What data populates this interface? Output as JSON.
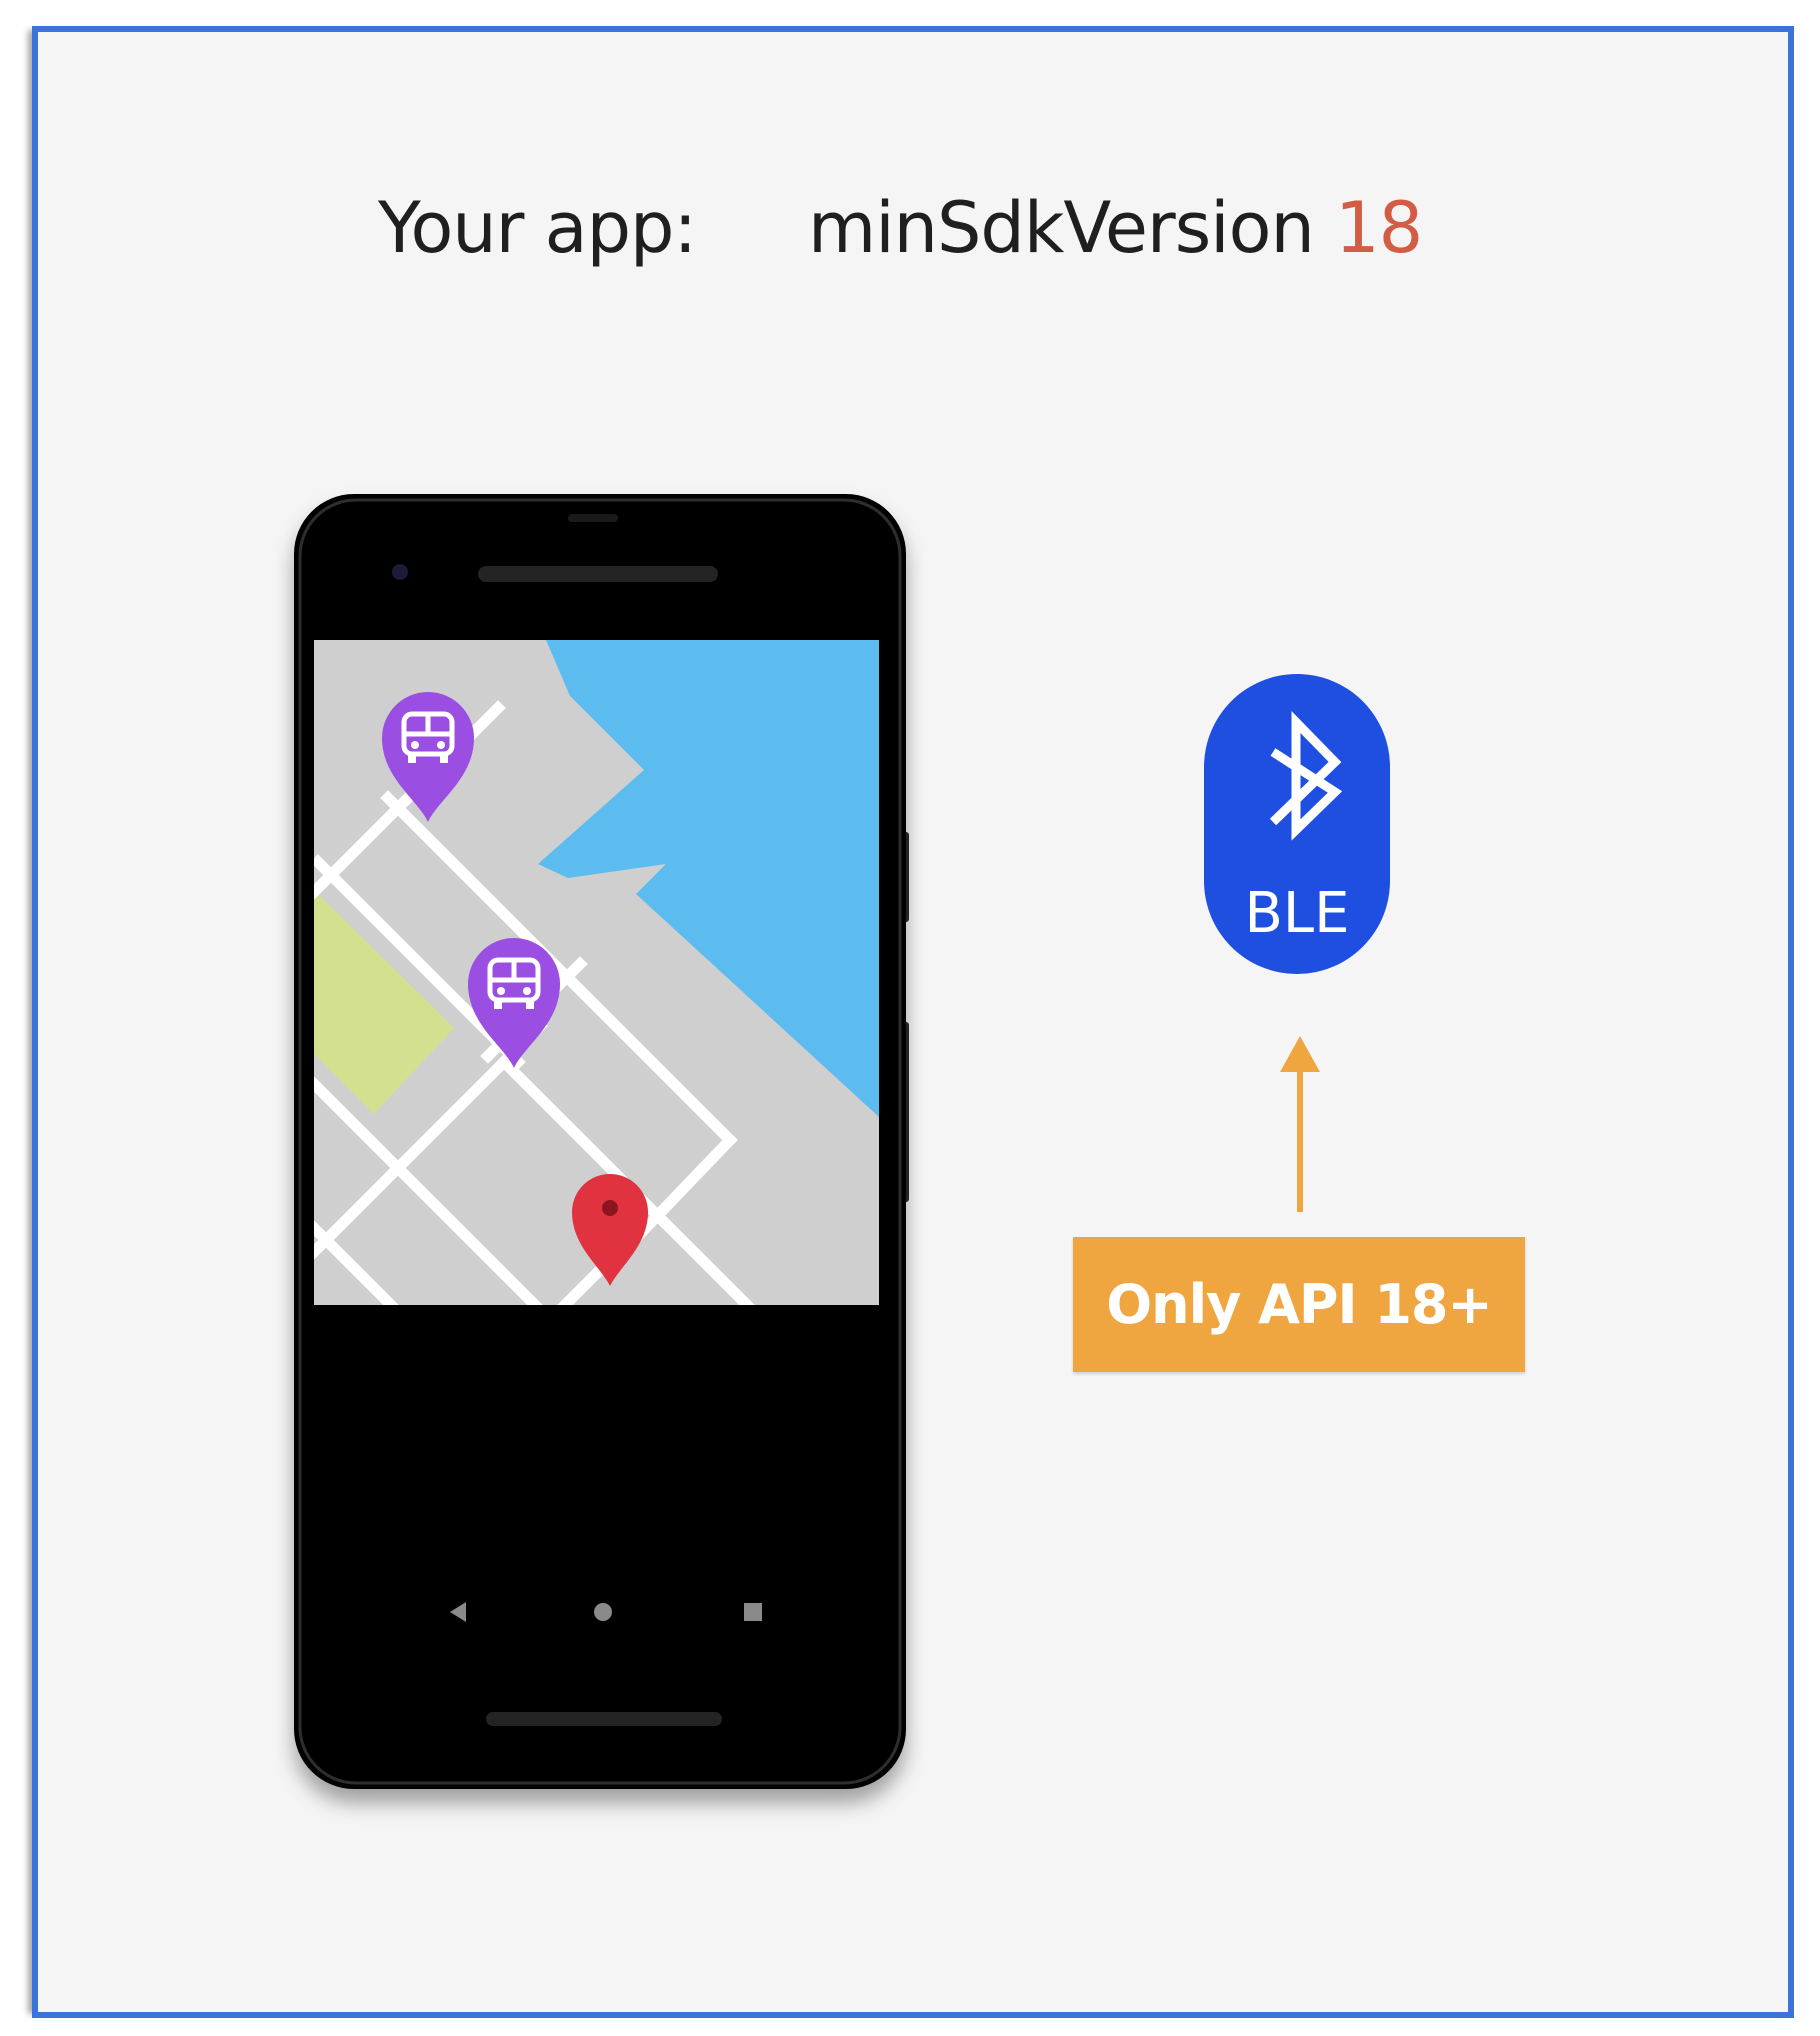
{
  "header": {
    "label": "Your app:",
    "key": "minSdkVersion",
    "value": "18"
  },
  "ble_badge": {
    "label": "BLE",
    "icon": "bluetooth-icon"
  },
  "api_note": {
    "label": "Only API 18+"
  },
  "colors": {
    "frame_border": "#3b74d8",
    "background": "#f5f5f5",
    "version_highlight": "#d35c44",
    "ble_blue": "#1f4fe0",
    "note_orange": "#f0a640",
    "map_water": "#5cbbef",
    "map_land": "#cfcfcf",
    "map_park": "#d3e08f",
    "bus_pin": "#9b4fe2",
    "destination_pin": "#e0323f",
    "app_button": "#4b4fe0"
  },
  "phone": {
    "nav_icons": [
      "back-icon",
      "home-icon",
      "recents-icon"
    ],
    "pins": [
      "bus-pin-icon",
      "bus-pin-icon",
      "map-pin-icon"
    ]
  }
}
